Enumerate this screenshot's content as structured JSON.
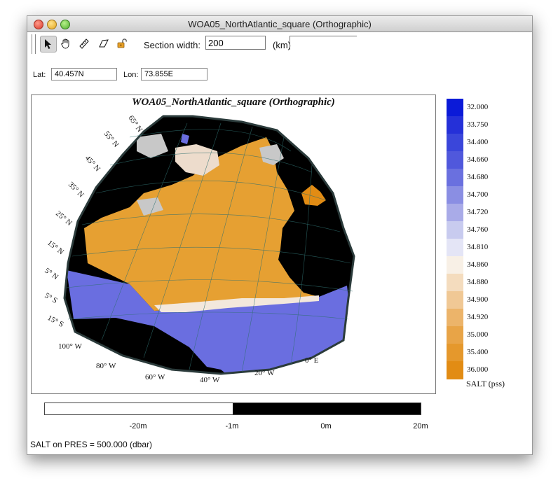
{
  "window": {
    "title": "WOA05_NorthAtlantic_square (Orthographic)"
  },
  "toolbar": {
    "tools": [
      {
        "name": "pointer-tool",
        "icon": "arrow-pointer-icon",
        "selected": true
      },
      {
        "name": "pan-tool",
        "icon": "hand-icon",
        "selected": false
      },
      {
        "name": "ruler-tool",
        "icon": "ruler-icon",
        "selected": false
      },
      {
        "name": "section-tool",
        "icon": "polygon-icon",
        "selected": false
      },
      {
        "name": "lock-tool",
        "icon": "padlock-icon",
        "selected": false
      }
    ],
    "section_width_label": "Section width:",
    "section_width_value": "200",
    "section_width_unit": "(km)"
  },
  "coords": {
    "lat_label": "Lat:",
    "lat_value": "40.457N",
    "lon_label": "Lon:",
    "lon_value": "73.855E"
  },
  "map": {
    "title": "WOA05_NorthAtlantic_square (Orthographic)",
    "lat_labels": [
      "65° N",
      "55° N",
      "45° N",
      "35° N",
      "25° N",
      "15° N",
      "5° N",
      "5° S",
      "15° S"
    ],
    "lon_labels": [
      "100° W",
      "80° W",
      "60° W",
      "40° W",
      "20° W",
      "0° E"
    ],
    "colors": {
      "land": "#000000",
      "ice": "#c8c8c8",
      "salty": "#e6a032",
      "fresh": "#6a6ee0"
    }
  },
  "legend": {
    "values": [
      "32.000",
      "33.750",
      "34.400",
      "34.660",
      "34.680",
      "34.700",
      "34.720",
      "34.760",
      "34.810",
      "34.860",
      "34.880",
      "34.900",
      "34.920",
      "35.000",
      "35.400",
      "36.000"
    ],
    "colors": [
      "#0b1ad8",
      "#2530d8",
      "#3a46da",
      "#5058dc",
      "#6a70df",
      "#8a8ee3",
      "#a9abe8",
      "#c8cbef",
      "#e4e5f6",
      "#f8f0e6",
      "#f4dcbe",
      "#f0c895",
      "#ecb46a",
      "#e8a447",
      "#e5982c",
      "#e28c14"
    ],
    "unit": "SALT (pss)"
  },
  "depth_bar": {
    "ticks": [
      "-20m",
      "-1m",
      "0m",
      "20m"
    ]
  },
  "status": "SALT on PRES = 500.000 (dbar)"
}
